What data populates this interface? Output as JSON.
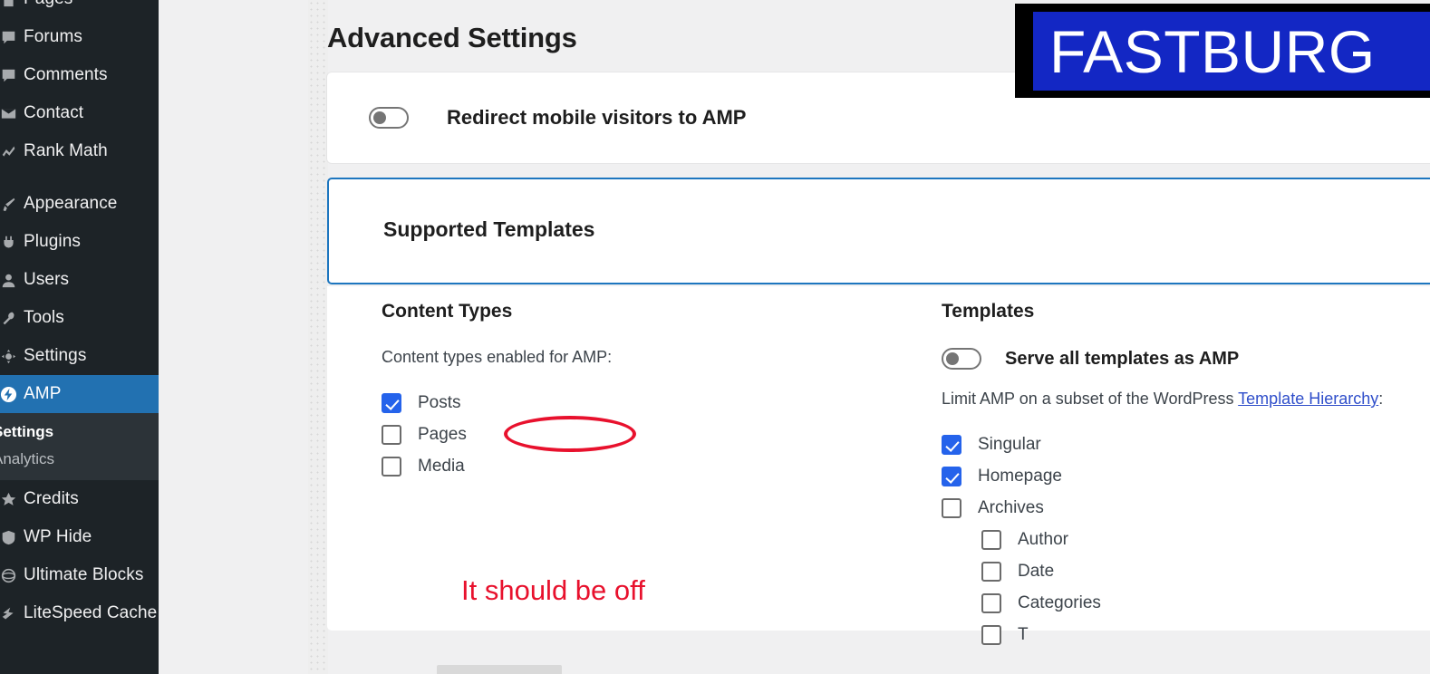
{
  "sidebar": {
    "items": [
      {
        "label": "Pages",
        "icon": "page-icon",
        "current": false,
        "clipped_top": true
      },
      {
        "label": "Forums",
        "icon": "comment-icon",
        "current": false
      },
      {
        "label": "Comments",
        "icon": "comment-icon",
        "current": false
      },
      {
        "label": "Contact",
        "icon": "envelope-icon",
        "current": false
      },
      {
        "label": "Rank Math",
        "icon": "rankmath-icon",
        "current": false
      },
      {
        "label": "Appearance",
        "icon": "brush-icon",
        "current": false,
        "separator_before": true
      },
      {
        "label": "Plugins",
        "icon": "plug-icon",
        "current": false
      },
      {
        "label": "Users",
        "icon": "user-icon",
        "current": false
      },
      {
        "label": "Tools",
        "icon": "tools-icon",
        "current": false
      },
      {
        "label": "Settings",
        "icon": "gear-icon",
        "current": false
      },
      {
        "label": "AMP",
        "icon": "amp-icon",
        "current": true
      },
      {
        "label": "Credits",
        "icon": "award-icon",
        "current": false
      },
      {
        "label": "WP Hide",
        "icon": "shield-icon",
        "current": false
      },
      {
        "label": "Ultimate Blocks",
        "icon": "blocks-icon",
        "current": false
      },
      {
        "label": "LiteSpeed Cache",
        "icon": "litespeed-icon",
        "current": false
      }
    ],
    "amp_submenu": [
      {
        "label": "Settings",
        "active": true
      },
      {
        "label": "Analytics",
        "active": false
      }
    ]
  },
  "page": {
    "title": "Advanced Settings"
  },
  "redirect_card": {
    "toggle_label": "Redirect mobile visitors to AMP",
    "toggle_state": "off"
  },
  "supported_templates": {
    "panel_title": "Supported Templates",
    "panel_border_color": "#1d76bf",
    "content_types": {
      "heading": "Content Types",
      "description": "Content types enabled for AMP:",
      "items": [
        {
          "label": "Posts",
          "checked": true
        },
        {
          "label": "Pages",
          "checked": false
        },
        {
          "label": "Media",
          "checked": false
        }
      ]
    },
    "templates": {
      "heading": "Templates",
      "serve_all_label": "Serve all templates as AMP",
      "serve_all_state": "off",
      "limit_text_before": "Limit AMP on a subset of the WordPress ",
      "limit_link": "Template Hierarchy",
      "limit_text_after": ":",
      "items": [
        {
          "label": "Singular",
          "checked": true,
          "indent": false
        },
        {
          "label": "Homepage",
          "checked": true,
          "indent": false
        },
        {
          "label": "Archives",
          "checked": false,
          "indent": false
        },
        {
          "label": "Author",
          "checked": false,
          "indent": true
        },
        {
          "label": "Date",
          "checked": false,
          "indent": true
        },
        {
          "label": "Categories",
          "checked": false,
          "indent": true
        },
        {
          "label": "T",
          "checked": false,
          "indent": true,
          "clipped": true
        }
      ]
    }
  },
  "annotations": {
    "ellipse_target": "Pages",
    "note_text": "It should be off",
    "color": "#e8112d"
  },
  "logo_overlay": {
    "text": "FASTBURG",
    "background": "#1327c4",
    "text_color": "#ffffff",
    "frame_color": "#000000"
  }
}
